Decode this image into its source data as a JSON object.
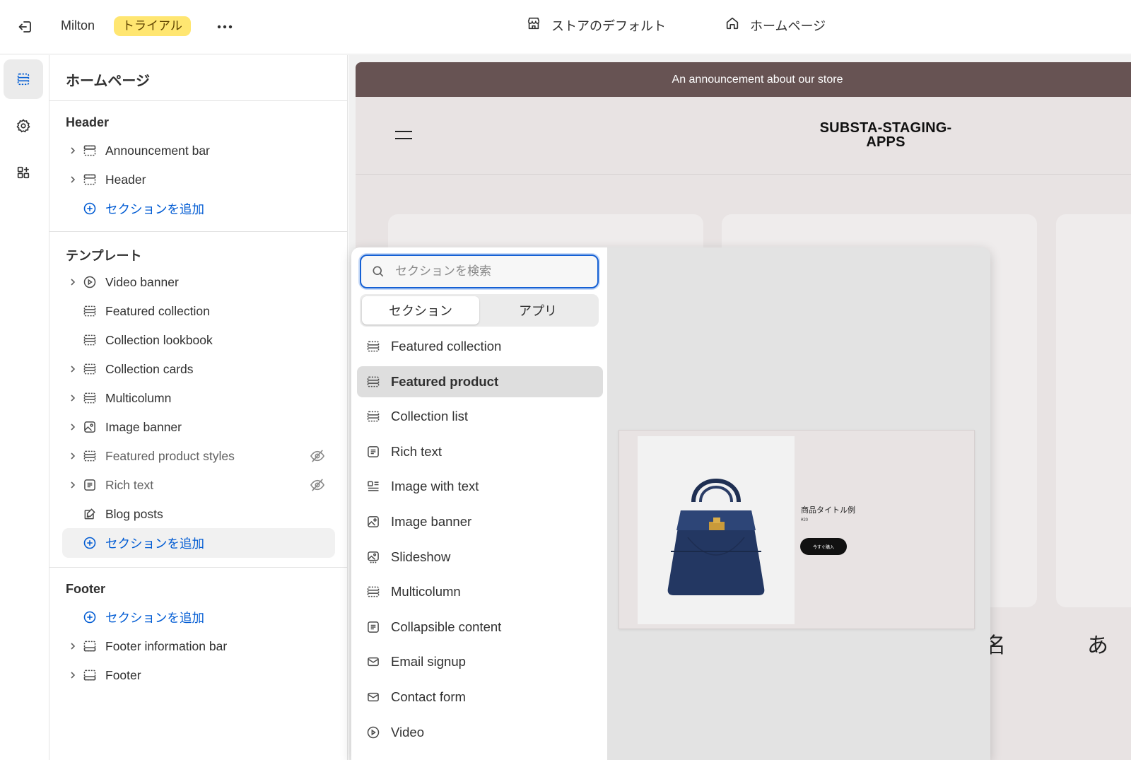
{
  "topbar": {
    "exit_icon": "exit-icon",
    "store_name": "Milton",
    "badge": "トライアル",
    "theme_label": "ストアのデフォルト",
    "page_label": "ホームページ"
  },
  "sidebar": {
    "title": "ホームページ",
    "header_group": {
      "label": "Header",
      "items": [
        {
          "label": "Announcement bar",
          "expandable": true
        },
        {
          "label": "Header",
          "expandable": true
        }
      ],
      "add_label": "セクションを追加"
    },
    "template_group": {
      "label": "テンプレート",
      "items": [
        {
          "label": "Video banner",
          "expandable": true,
          "hidden": false
        },
        {
          "label": "Featured collection",
          "expandable": false,
          "hidden": false
        },
        {
          "label": "Collection lookbook",
          "expandable": false,
          "hidden": false
        },
        {
          "label": "Collection cards",
          "expandable": true,
          "hidden": false
        },
        {
          "label": "Multicolumn",
          "expandable": true,
          "hidden": false
        },
        {
          "label": "Image banner",
          "expandable": true,
          "hidden": false
        },
        {
          "label": "Featured product styles",
          "expandable": true,
          "hidden": true
        },
        {
          "label": "Rich text",
          "expandable": true,
          "hidden": true
        },
        {
          "label": "Blog posts",
          "expandable": false,
          "hidden": false
        }
      ],
      "add_label": "セクションを追加"
    },
    "footer_group": {
      "label": "Footer",
      "add_label": "セクションを追加",
      "items": [
        {
          "label": "Footer information bar",
          "expandable": true
        },
        {
          "label": "Footer",
          "expandable": true
        }
      ]
    }
  },
  "preview": {
    "announcement": "An announcement about our store",
    "logo": "SUBSTA-STAGING-APPS",
    "logo_line1": "SUBSTA-STAGING-",
    "logo_line2": "APPS",
    "jp_fragment_1": "の名",
    "jp_fragment_2": "あ"
  },
  "picker": {
    "search_placeholder": "セクションを検索",
    "tabs": [
      "セクション",
      "アプリ"
    ],
    "active_tab": "セクション",
    "items": [
      {
        "label": "Featured collection",
        "icon": "section-icon",
        "selected": false
      },
      {
        "label": "Featured product",
        "icon": "section-icon",
        "selected": true
      },
      {
        "label": "Collection list",
        "icon": "section-icon",
        "selected": false
      },
      {
        "label": "Rich text",
        "icon": "text-icon",
        "selected": false
      },
      {
        "label": "Image with text",
        "icon": "image-text-icon",
        "selected": false
      },
      {
        "label": "Image banner",
        "icon": "image-icon",
        "selected": false
      },
      {
        "label": "Slideshow",
        "icon": "slideshow-icon",
        "selected": false
      },
      {
        "label": "Multicolumn",
        "icon": "section-icon",
        "selected": false
      },
      {
        "label": "Collapsible content",
        "icon": "text-icon",
        "selected": false
      },
      {
        "label": "Email signup",
        "icon": "email-icon",
        "selected": false
      },
      {
        "label": "Contact form",
        "icon": "email-icon",
        "selected": false
      },
      {
        "label": "Video",
        "icon": "play-icon",
        "selected": false
      }
    ],
    "product_preview": {
      "title": "商品タイトル例",
      "price": "¥20",
      "button": "今すぐ購入"
    }
  },
  "colors": {
    "accent": "#005bd3",
    "badge_bg": "#ffe671",
    "announcement_bg": "#675353"
  }
}
